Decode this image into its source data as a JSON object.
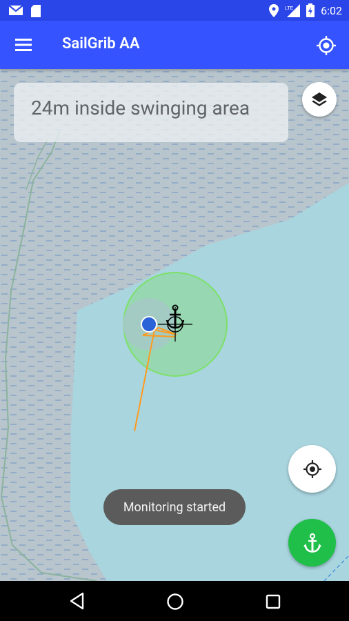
{
  "status_bar": {
    "time": "6:02",
    "icons": [
      "gmail-icon",
      "sd-card-icon",
      "location-icon",
      "lte-signal-icon",
      "battery-icon"
    ],
    "network": "LTE"
  },
  "app_bar": {
    "title": "SailGrib AA",
    "menu_icon": "hamburger-menu-icon",
    "action_icon": "gps-fixed-icon",
    "color": "#3554ff"
  },
  "map": {
    "alarm_message": "24m inside swinging area",
    "layers_icon": "layers-icon",
    "recenter_icon": "my-location-icon",
    "anchor_icon": "anchor-icon",
    "swing_circle_color": "#7ee06a",
    "track_color": "#ff9a1f",
    "boat_color": "#2a62d8"
  },
  "toast": {
    "message": "Monitoring started"
  },
  "fab": {
    "color": "#1fbf4a"
  },
  "nav_bar": {
    "back_icon": "back-triangle-icon",
    "home_icon": "home-circle-icon",
    "recent_icon": "recent-apps-square-icon"
  }
}
